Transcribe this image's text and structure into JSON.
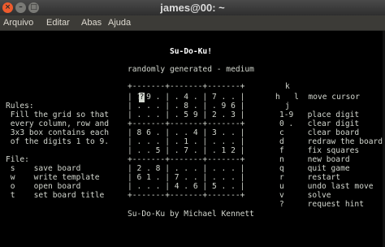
{
  "window": {
    "title": "james@00: ~"
  },
  "menu": [
    "Arquivo",
    "Editar",
    "Abas",
    "Ajuda"
  ],
  "game": {
    "title": "Su-Do-Ku!",
    "subtitle": "randomly generated - medium",
    "footer": "Su-Do-Ku by Michael Kennett",
    "cursor_digit": "?"
  },
  "board_lines": [
    "+-------+-------+-------+",
    "| ? 9 . | . 4 . | 7 . . |",
    "| . . . | . 8 . | . 9 6 |",
    "| . . . | . 5 9 | 2 . 3 |",
    "+-------+-------+-------+",
    "| 8 6 . | . . 4 | 3 . . |",
    "| . . . | . 1 . | . . . |",
    "| . . 5 | . 7 . | . 1 2 |",
    "+-------+-------+-------+",
    "| 2 . 8 | . . . | . . . |",
    "| 6 1 . | 7 . . | . . . |",
    "| . . . | 4 . 6 | 5 . . |",
    "+-------+-------+-------+"
  ],
  "rules": {
    "heading": "Rules:",
    "lines": [
      " Fill the grid so that",
      " every column, row and",
      " 3x3 box contains each",
      " of the digits 1 to 9."
    ]
  },
  "file": {
    "heading": "File:",
    "lines": [
      " s    save board",
      " w    write template",
      " o    open board",
      " t    set board title"
    ]
  },
  "keys": {
    "k": "k",
    "move": "h   l  move cursor",
    "j": "j",
    "lines": [
      "1-9   place digit",
      "0 .   clear digit",
      "c     clear board",
      "d     redraw the board",
      "f     fix squares",
      "n     new board",
      "q     quit game",
      "r     restart",
      "u     undo last move",
      "v     solve",
      "?     request hint"
    ]
  }
}
